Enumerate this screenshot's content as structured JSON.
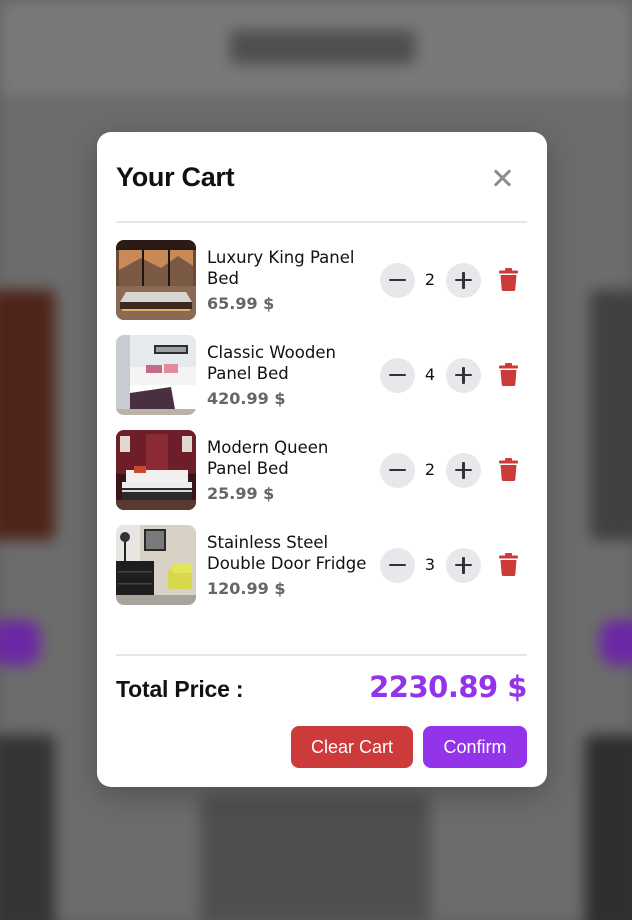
{
  "colors": {
    "accent": "#9333ea",
    "danger": "#cc3a3a",
    "price_text": "#666666",
    "qty_button_bg": "#e8e8ec"
  },
  "background": {
    "brand": "SOME Store"
  },
  "modal": {
    "title": "Your Cart",
    "close_icon": "close-icon",
    "items": [
      {
        "name": "Luxury King Panel Bed",
        "price": "65.99 $",
        "quantity": "2",
        "image": "bed-mountain-view-image"
      },
      {
        "name": "Classic Wooden Panel Bed",
        "price": "420.99 $",
        "quantity": "4",
        "image": "bedroom-white-wall-image"
      },
      {
        "name": "Modern Queen Panel Bed",
        "price": "25.99 $",
        "quantity": "2",
        "image": "bedroom-red-wall-image"
      },
      {
        "name": "Stainless Steel Double Door Fridge",
        "price": "120.99 $",
        "quantity": "3",
        "image": "living-room-yellow-chair-image"
      }
    ],
    "icons": {
      "minus": "minus-icon",
      "plus": "plus-icon",
      "delete": "trash-icon"
    },
    "total_label": "Total Price :",
    "total_value": "2230.89 $",
    "clear_label": "Clear Cart",
    "confirm_label": "Confirm"
  }
}
